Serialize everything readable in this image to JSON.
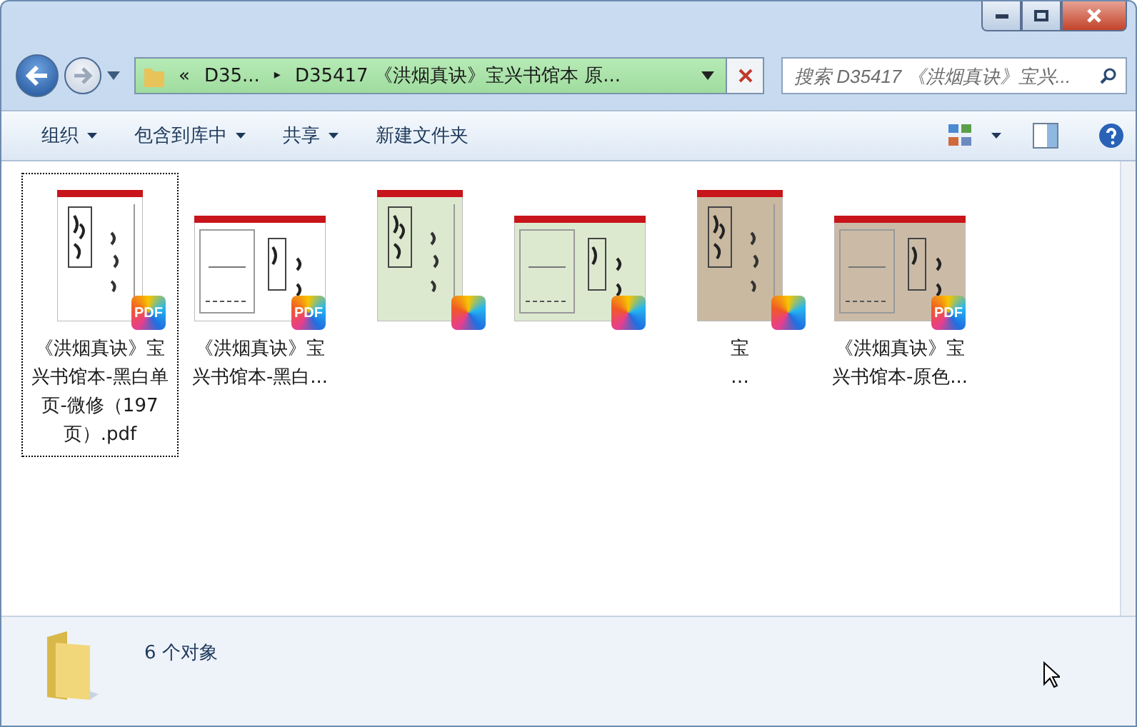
{
  "address": {
    "overflow": "«",
    "crumbs": [
      {
        "label": "D35...",
        "separator": "▸"
      },
      {
        "label": "D35417 《洪烟真诀》宝兴书馆本 原..."
      }
    ]
  },
  "search": {
    "placeholder": "搜索 D35417 《洪烟真诀》宝兴..."
  },
  "toolbar": [
    {
      "label": "组织",
      "dropdown": true
    },
    {
      "label": "包含到库中",
      "dropdown": true
    },
    {
      "label": "共享",
      "dropdown": true
    },
    {
      "label": "新建文件夹",
      "dropdown": false
    }
  ],
  "files": [
    {
      "lines": [
        "《洪烟真诀》宝",
        "兴书馆本-黑白单",
        "页-微修（197",
        "页）.pdf"
      ],
      "badge": "PDF",
      "focused": true
    },
    {
      "lines": [
        "《洪烟真诀》宝",
        "兴书馆本-黑白..."
      ],
      "badge": "PDF",
      "focused": false
    },
    {
      "focused": false
    },
    {
      "focused": false
    },
    {
      "lines": [
        "宝",
        "…"
      ],
      "focused": false
    },
    {
      "lines": [
        "《洪烟真诀》宝",
        "兴书馆本-原色..."
      ],
      "badge": "PDF",
      "focused": false
    }
  ],
  "status": {
    "count": "6 个对象"
  }
}
